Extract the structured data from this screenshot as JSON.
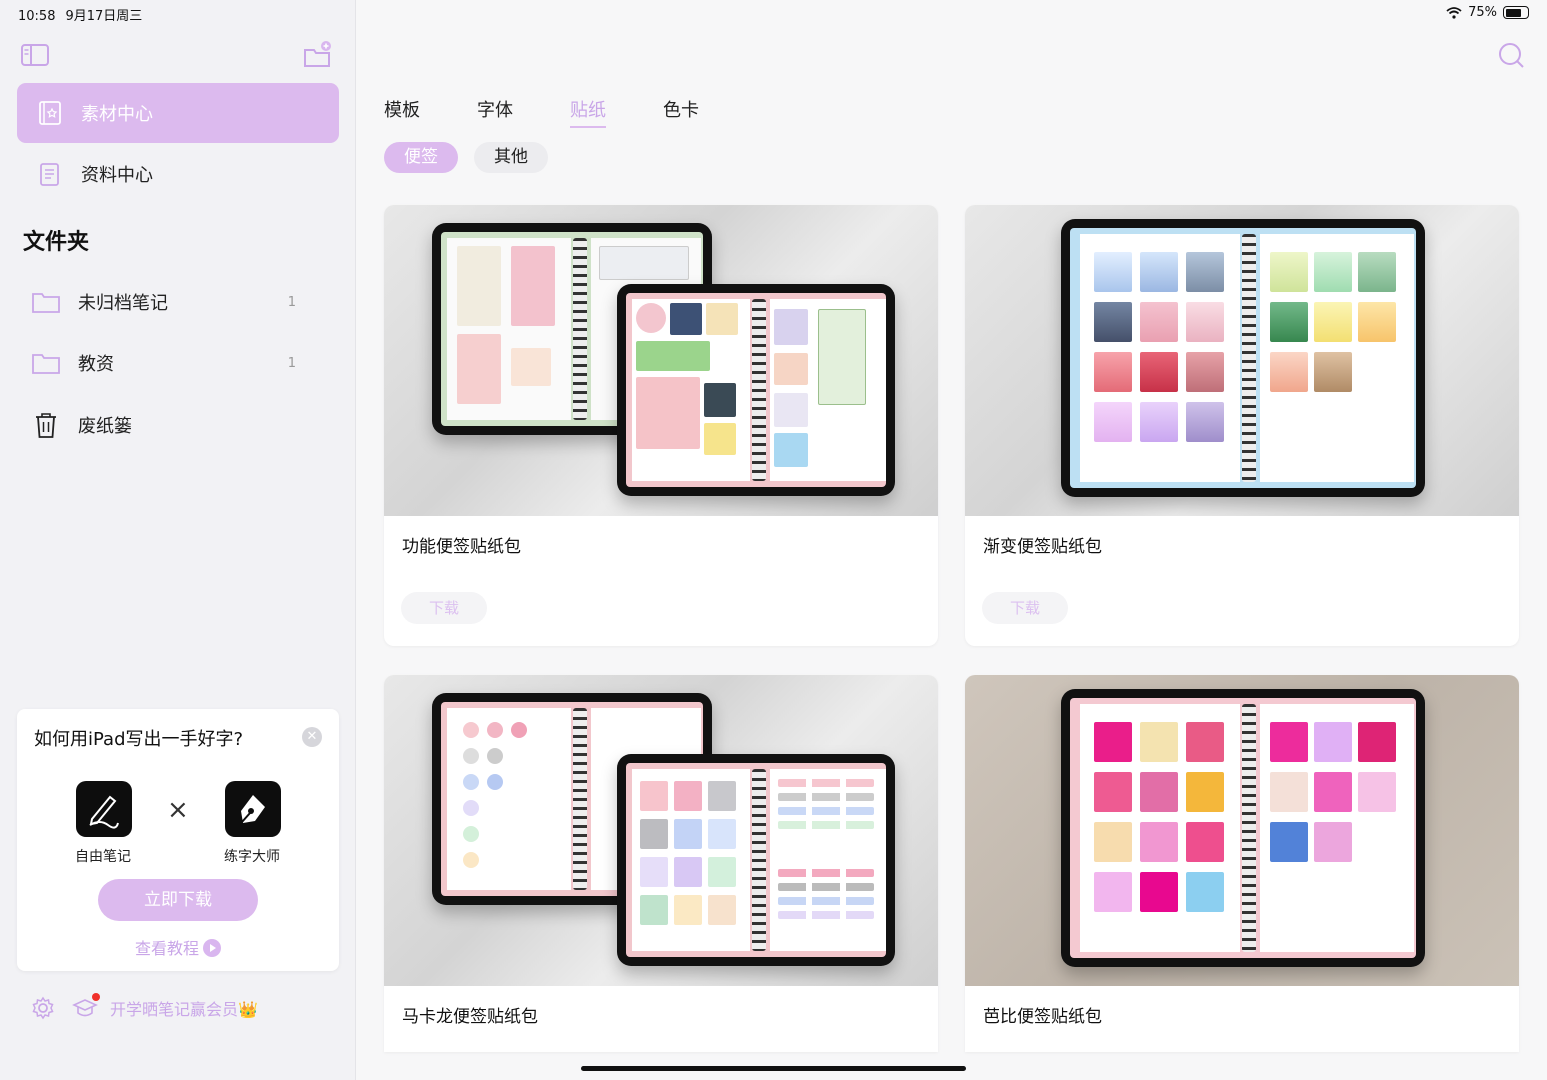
{
  "status": {
    "time": "10:58",
    "date": "9月17日周三",
    "battery": "75%"
  },
  "sidebar": {
    "nav": [
      {
        "label": "素材中心",
        "icon": "material-center-icon"
      },
      {
        "label": "资料中心",
        "icon": "document-center-icon"
      }
    ],
    "folders_title": "文件夹",
    "folders": [
      {
        "label": "未归档笔记",
        "count": "1",
        "icon": "folder-icon"
      },
      {
        "label": "教资",
        "count": "1",
        "icon": "folder-icon"
      },
      {
        "label": "废纸篓",
        "count": "",
        "icon": "trash-icon"
      }
    ],
    "promo": {
      "title": "如何用iPad写出一手好字?",
      "app1": "自由笔记",
      "times": "×",
      "app2": "练字大师",
      "button": "立即下载",
      "link": "查看教程"
    },
    "bottom_text": "开学晒笔记赢会员👑"
  },
  "tabs": [
    "模板",
    "字体",
    "贴纸",
    "色卡"
  ],
  "active_tab": "贴纸",
  "chips": [
    "便签",
    "其他"
  ],
  "cards": [
    {
      "title": "功能便签贴纸包",
      "button": "下载"
    },
    {
      "title": "渐变便签贴纸包",
      "button": "下载"
    },
    {
      "title": "马卡龙便签贴纸包",
      "button": ""
    },
    {
      "title": "芭比便签贴纸包",
      "button": ""
    }
  ],
  "colors": {
    "accent": "#dcbaee",
    "accent_text": "#c9a6e8"
  }
}
